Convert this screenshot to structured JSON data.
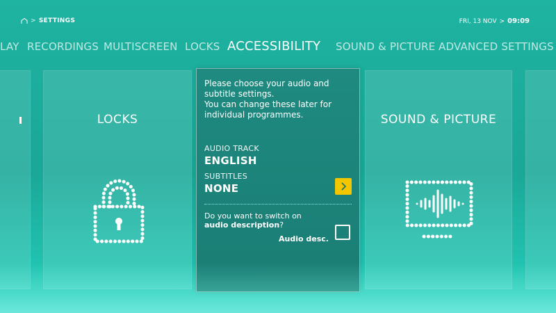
{
  "header": {
    "breadcrumb": "SETTINGS",
    "breadcrumb_sep": ">",
    "date": "FRI, 13 NOV",
    "date_sep": ">",
    "time": "09:09"
  },
  "tabs": [
    {
      "label": "LAY"
    },
    {
      "label": "RECORDINGS"
    },
    {
      "label": "MULTISCREEN"
    },
    {
      "label": "LOCKS"
    },
    {
      "label": "ACCESSIBILITY",
      "active": true
    },
    {
      "label": "SOUND & PICTURE"
    },
    {
      "label": "ADVANCED SETTINGS"
    }
  ],
  "cards": {
    "locks": {
      "title": "LOCKS",
      "icon": "padlock-icon"
    },
    "sound_picture": {
      "title": "SOUND & PICTURE",
      "icon": "monitor-soundwave-icon"
    }
  },
  "panel": {
    "intro": "Please choose your audio and subtitle settings.\nYou can change these later for individual programmes.",
    "audio_track_label": "AUDIO TRACK",
    "audio_track_value": "ENGLISH",
    "subtitles_label": "SUBTITLES",
    "subtitles_value": "NONE",
    "question_prefix": "Do you want to switch on",
    "question_emph": "audio description",
    "question_suffix": "?",
    "checkbox_label": "Audio desc.",
    "checkbox_checked": false
  },
  "colors": {
    "accent_yellow": "#f2c700",
    "background_teal": "#1aa898",
    "panel_teal": "#1f8a80"
  }
}
